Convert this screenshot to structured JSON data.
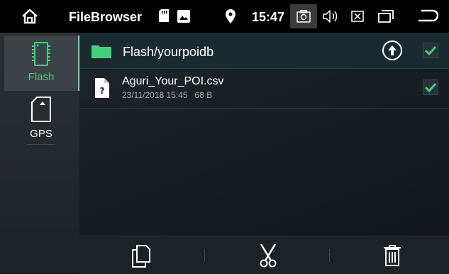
{
  "statusbar": {
    "app_title": "FileBrowser",
    "time": "15:47"
  },
  "sidebar": {
    "items": [
      {
        "label": "Flash",
        "icon": "chip-icon",
        "selected": true
      },
      {
        "label": "GPS",
        "icon": "sdcard-icon",
        "selected": false
      }
    ]
  },
  "pathbar": {
    "path": "Flash/yourpoidb"
  },
  "files": [
    {
      "name": "Aguri_Your_POI.csv",
      "date": "23/11/2018 15:45",
      "size": "68 B",
      "checked": true
    }
  ],
  "colors": {
    "accent": "#3fd27a",
    "path_bar": "#1a2b30"
  }
}
